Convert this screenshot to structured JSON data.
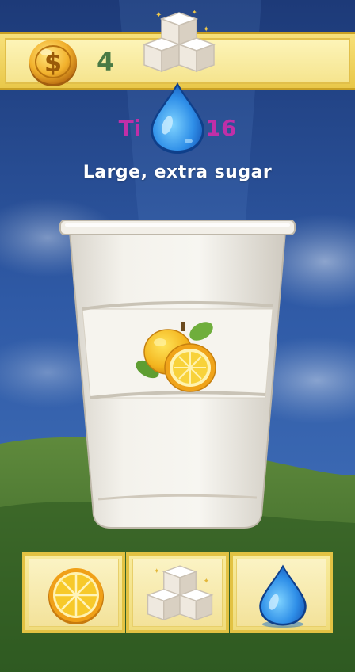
{
  "hud": {
    "coins": "4",
    "timer_visible_prefix": "Ti",
    "timer_visible_suffix": ":16"
  },
  "order": {
    "text": "Large, extra sugar"
  },
  "icons": {
    "coin": "coin-icon",
    "sugar": "sugar-cubes-icon",
    "water": "water-drop-icon",
    "lemon": "lemon-icon",
    "lemon_slice": "lemon-slice-icon"
  },
  "colors": {
    "timer": "#c02fa8",
    "coin_count": "#4a7a45",
    "tray_border": "#e2c243",
    "water": "#2f8fe8"
  },
  "ingredients": [
    {
      "id": "lemon",
      "icon": "lemon-slice-icon"
    },
    {
      "id": "sugar",
      "icon": "sugar-cubes-icon"
    },
    {
      "id": "water",
      "icon": "water-drop-icon"
    }
  ]
}
